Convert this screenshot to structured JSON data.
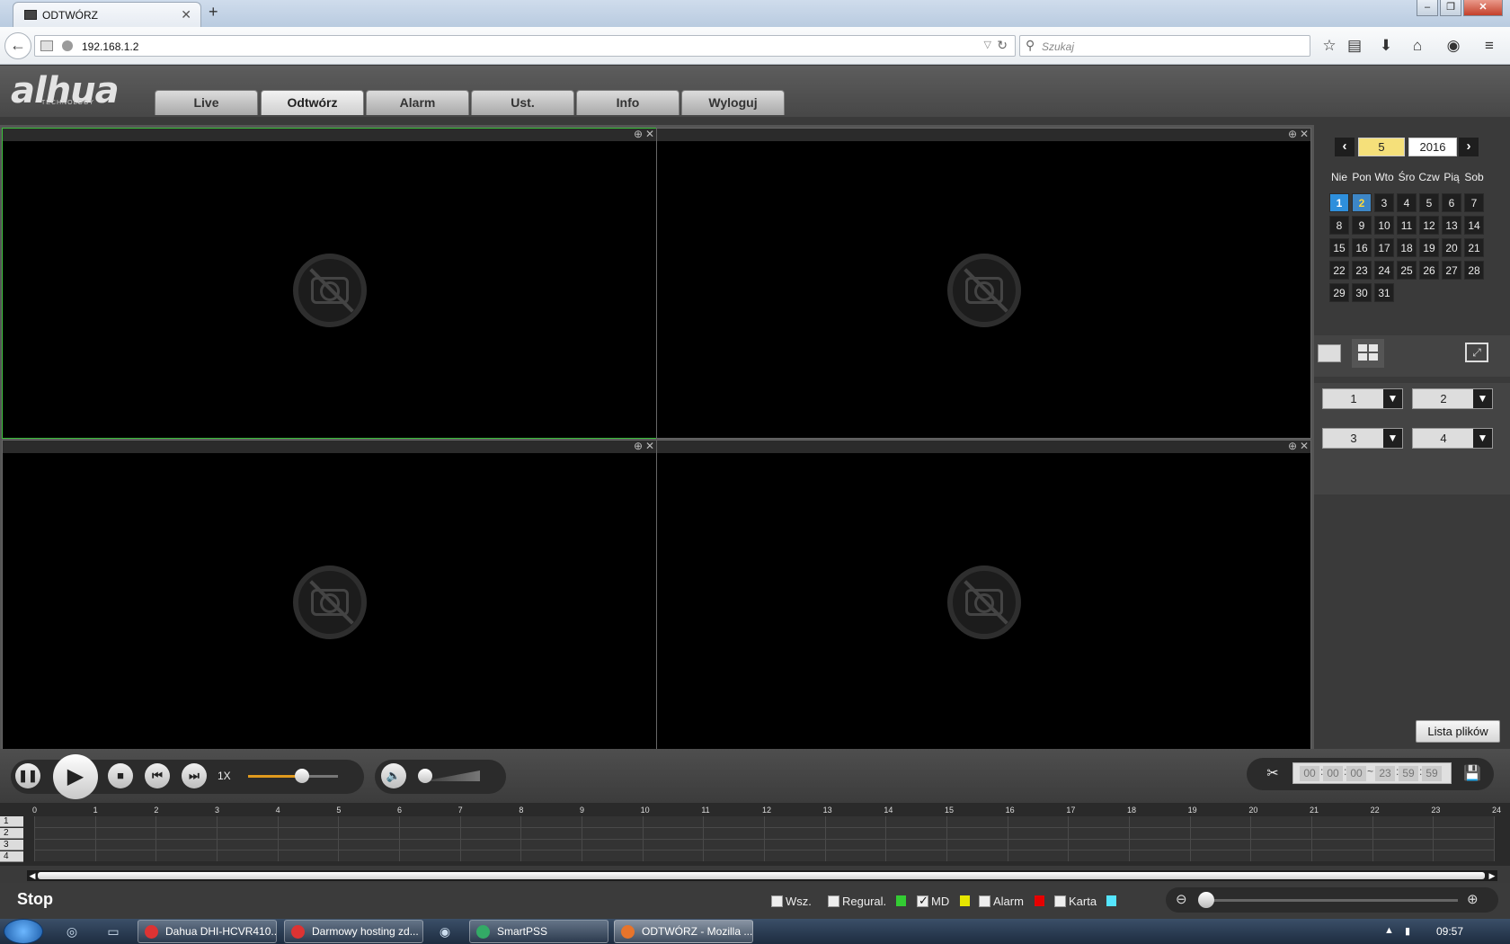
{
  "browser": {
    "tab_title": "ODTWÓRZ",
    "url": "192.168.1.2",
    "search_placeholder": "Szukaj"
  },
  "app": {
    "nav": [
      "Live",
      "Odtwórz",
      "Alarm",
      "Ust.",
      "Info",
      "Wyloguj"
    ],
    "active_nav": "Odtwórz"
  },
  "calendar": {
    "month": "5",
    "year": "2016",
    "weekdays": [
      "Nie",
      "Pon",
      "Wto",
      "Śro",
      "Czw",
      "Pią",
      "Sob"
    ],
    "selected_day": 1,
    "recording_days": [
      2
    ]
  },
  "channels": [
    "1",
    "2",
    "3",
    "4"
  ],
  "file_list_button": "Lista plików",
  "playback": {
    "speed": "1X",
    "speed_slider": 0.6,
    "volume": 0.0,
    "clip_start": [
      "00",
      "00",
      "00"
    ],
    "clip_end": [
      "23",
      "59",
      "59"
    ],
    "time_sep": ":",
    "range_sep": "~"
  },
  "timeline": {
    "hours": [
      "0",
      "1",
      "2",
      "3",
      "4",
      "5",
      "6",
      "7",
      "8",
      "9",
      "10",
      "11",
      "12",
      "13",
      "14",
      "15",
      "16",
      "17",
      "18",
      "19",
      "20",
      "21",
      "22",
      "23",
      "24"
    ],
    "channel_labels": [
      "1",
      "2",
      "3",
      "4"
    ]
  },
  "status": {
    "state": "Stop",
    "legend": [
      {
        "label": "Wsz.",
        "checked": false,
        "color": null
      },
      {
        "label": "Regural.",
        "checked": false,
        "color": "#33cc33"
      },
      {
        "label": "MD",
        "checked": true,
        "color": "#e6e600"
      },
      {
        "label": "Alarm",
        "checked": false,
        "color": "#e60000"
      },
      {
        "label": "Karta",
        "checked": false,
        "color": "#55e5ff"
      }
    ]
  },
  "taskbar": {
    "items": [
      {
        "label": "Dahua DHI-HCVR410...",
        "icon_color": "#d33"
      },
      {
        "label": "Darmowy hosting zd...",
        "icon_color": "#d33"
      },
      {
        "label": "SmartPSS",
        "icon_color": "#3a6"
      },
      {
        "label": "ODTWÓRZ - Mozilla ...",
        "icon_color": "#e7742b"
      }
    ],
    "clock": "09:57"
  }
}
